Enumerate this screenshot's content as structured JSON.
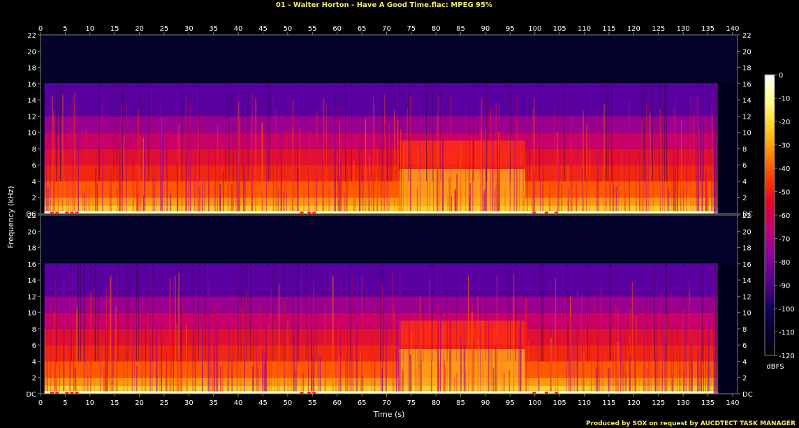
{
  "title": "01 - Walter Horton - Have A Good Time.flac: MPEG 95%",
  "footer": "Produced by SOX on request by AUCDTECT TASK MANAGER",
  "colors": {
    "title": "#f4ee60",
    "footer": "#f4ee60",
    "axis_text": "#ffffff",
    "axis_line": "#7f7f7f",
    "background": "#000000"
  },
  "chart_data": {
    "type": "heatmap",
    "xlabel": "Time (s)",
    "ylabel": "Frequency (kHz)",
    "colorbar_label": "dBFS",
    "x_ticks": [
      "0",
      "5",
      "10",
      "15",
      "20",
      "25",
      "30",
      "35",
      "40",
      "45",
      "50",
      "55",
      "60",
      "65",
      "70",
      "75",
      "80",
      "85",
      "90",
      "95",
      "100",
      "105",
      "110",
      "115",
      "120",
      "125",
      "130",
      "135",
      "140"
    ],
    "y_ticks": [
      "DC",
      "2",
      "4",
      "6",
      "8",
      "10",
      "12",
      "14",
      "16",
      "18",
      "20",
      "22"
    ],
    "colorbar_ticks": [
      "0",
      "-10",
      "-20",
      "-30",
      "-40",
      "-50",
      "-60",
      "-70",
      "-80",
      "-90",
      "-100",
      "-110",
      "-120"
    ],
    "xlim": [
      0,
      141
    ],
    "ylim": [
      0,
      22
    ],
    "zlim": [
      -120,
      0
    ],
    "channels": 2,
    "track_end_s": 137,
    "lowpass_cutoff_khz": 16,
    "dense_segment_s": [
      72.5,
      98
    ],
    "colormap": [
      "#000000",
      "#000030",
      "#1a0060",
      "#5a0090",
      "#9000a0",
      "#c0007a",
      "#e8002a",
      "#ff3a00",
      "#ff8a00",
      "#ffcf20",
      "#ffff80",
      "#ffffff"
    ]
  }
}
